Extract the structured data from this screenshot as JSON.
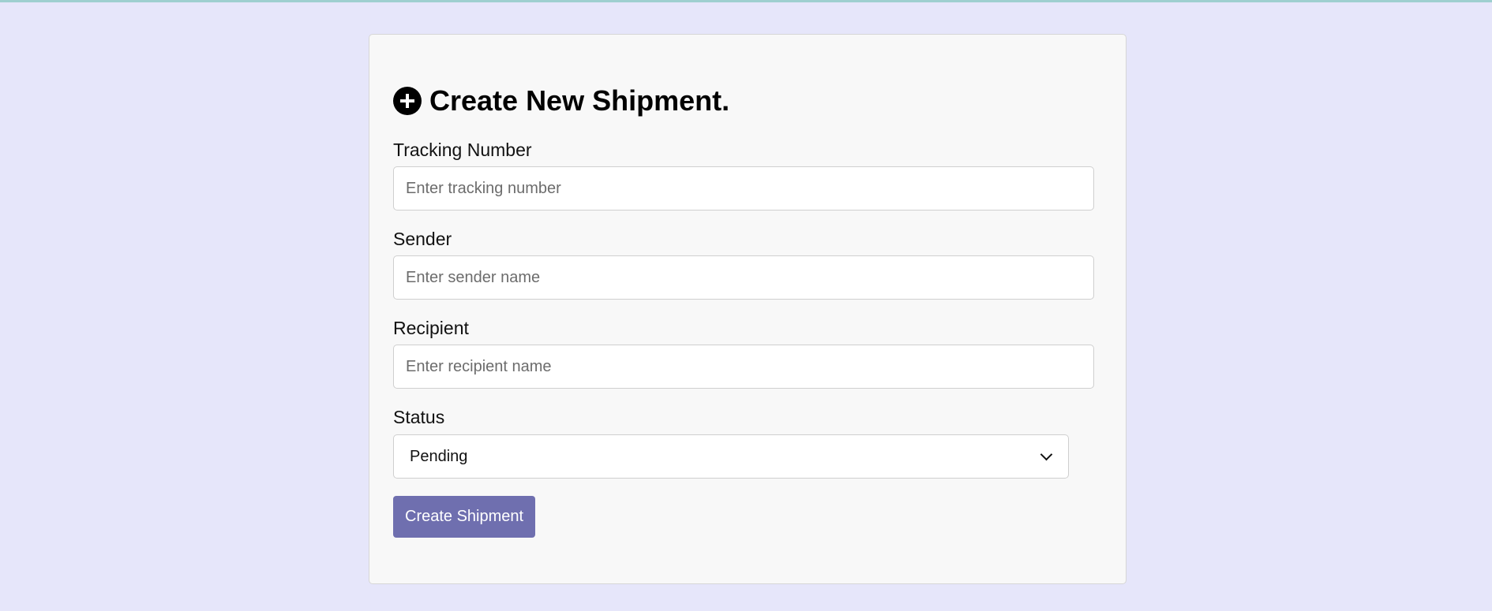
{
  "colors": {
    "background": "#e6e6fa",
    "card": "#f8f8f8",
    "accent": "#6f6faf",
    "top_strip": "#9ecfcf"
  },
  "form": {
    "title_icon": "plus-circle-icon",
    "title": "Create New Shipment.",
    "tracking": {
      "label": "Tracking Number",
      "value": "",
      "placeholder": "Enter tracking number"
    },
    "sender": {
      "label": "Sender",
      "value": "",
      "placeholder": "Enter sender name"
    },
    "recipient": {
      "label": "Recipient",
      "value": "",
      "placeholder": "Enter recipient name"
    },
    "status": {
      "label": "Status",
      "selected": "Pending",
      "icon": "chevron-down-icon"
    },
    "submit_label": "Create Shipment"
  }
}
